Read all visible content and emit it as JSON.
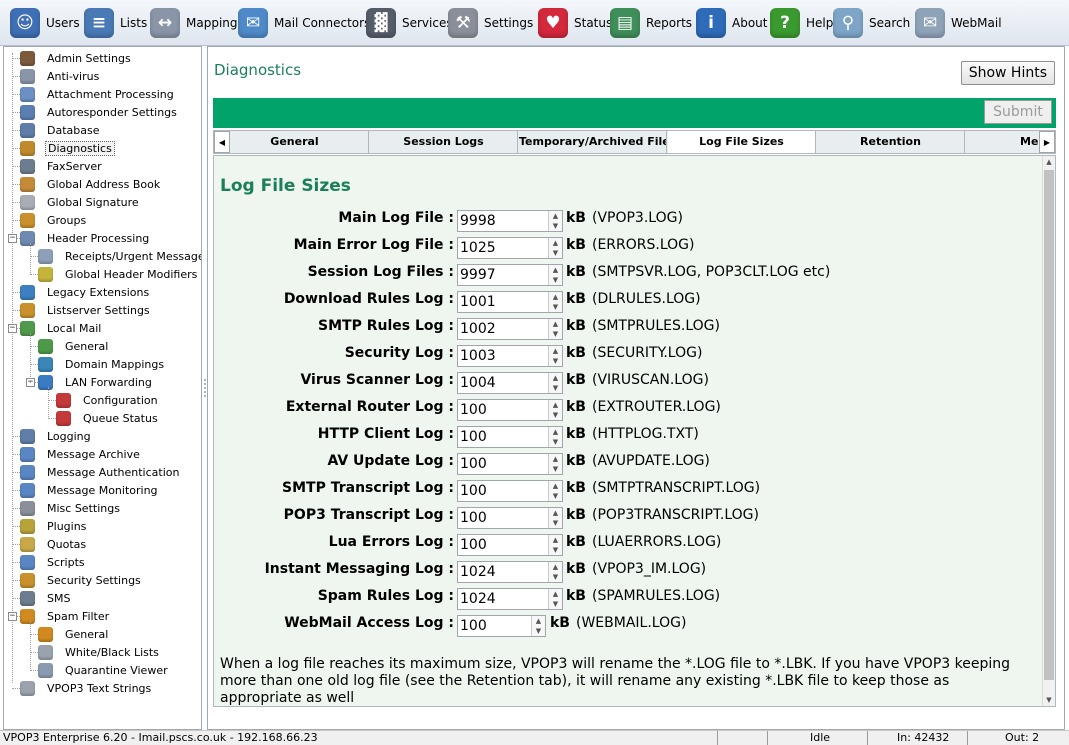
{
  "toolbar": {
    "items": [
      {
        "label": "Users",
        "icon": "users-icon",
        "color": "#3f6fb4",
        "glyph": "☺"
      },
      {
        "label": "Lists",
        "icon": "lists-icon",
        "color": "#4a7ab6",
        "glyph": "≡"
      },
      {
        "label": "Mappings",
        "icon": "mappings-icon",
        "color": "#8a96a8",
        "glyph": "↔"
      },
      {
        "label": "Mail Connectors",
        "icon": "mail-connectors-icon",
        "color": "#4e8ac9",
        "glyph": "✉"
      },
      {
        "label": "Services",
        "icon": "services-icon",
        "color": "#555d6b",
        "glyph": "▓"
      },
      {
        "label": "Settings",
        "icon": "settings-icon",
        "color": "#8a8f99",
        "glyph": "⚒"
      },
      {
        "label": "Status",
        "icon": "status-icon",
        "color": "#d4283c",
        "glyph": "♥"
      },
      {
        "label": "Reports",
        "icon": "reports-icon",
        "color": "#3f8f5a",
        "glyph": "▤"
      },
      {
        "label": "About",
        "icon": "about-icon",
        "color": "#2e6bb8",
        "glyph": "i"
      },
      {
        "label": "Help",
        "icon": "help-icon",
        "color": "#3b9a2f",
        "glyph": "?"
      },
      {
        "label": "Search",
        "icon": "search-icon",
        "color": "#7ea5c8",
        "glyph": "⚲"
      },
      {
        "label": "WebMail",
        "icon": "webmail-icon",
        "color": "#8fa3b8",
        "glyph": "✉"
      }
    ]
  },
  "tree": {
    "items": [
      {
        "label": "Admin Settings",
        "icon": "admin-settings-icon",
        "color": "#7c5a3c"
      },
      {
        "label": "Anti-virus",
        "icon": "anti-virus-icon",
        "color": "#8a95a8"
      },
      {
        "label": "Attachment Processing",
        "icon": "paperclip-icon",
        "color": "#6c8fc4"
      },
      {
        "label": "Autoresponder Settings",
        "icon": "autoresponder-icon",
        "color": "#5b7fb3"
      },
      {
        "label": "Database",
        "icon": "database-icon",
        "color": "#5f7ea8"
      },
      {
        "label": "Diagnostics",
        "icon": "diagnostics-icon",
        "color": "#c08a2a"
      },
      {
        "label": "FaxServer",
        "icon": "fax-icon",
        "color": "#6b7d8f"
      },
      {
        "label": "Global Address Book",
        "icon": "address-book-icon",
        "color": "#c48a3a"
      },
      {
        "label": "Global Signature",
        "icon": "signature-icon",
        "color": "#a8adb5"
      },
      {
        "label": "Groups",
        "icon": "groups-icon",
        "color": "#c9902d"
      },
      {
        "label": "Header Processing",
        "icon": "header-processing-icon",
        "color": "#6e8ab0"
      },
      {
        "label": "Receipts/Urgent Messages",
        "icon": "receipts-icon",
        "color": "#8ea0b8"
      },
      {
        "label": "Global Header Modifiers",
        "icon": "header-modifiers-icon",
        "color": "#c4b43a"
      },
      {
        "label": "Legacy Extensions",
        "icon": "legacy-extensions-icon",
        "color": "#3d7fc0"
      },
      {
        "label": "Listserver Settings",
        "icon": "listserver-icon",
        "color": "#c9902d"
      },
      {
        "label": "Local Mail",
        "icon": "local-mail-icon",
        "color": "#4f9a4a"
      },
      {
        "label": "General",
        "icon": "general-icon",
        "color": "#4f9a4a"
      },
      {
        "label": "Domain Mappings",
        "icon": "globe-icon",
        "color": "#3a86b8"
      },
      {
        "label": "LAN Forwarding",
        "icon": "lan-forwarding-icon",
        "color": "#3a7bc2"
      },
      {
        "label": "Configuration",
        "icon": "configuration-icon",
        "color": "#c43a3a"
      },
      {
        "label": "Queue Status",
        "icon": "queue-status-icon",
        "color": "#c43a3a"
      },
      {
        "label": "Logging",
        "icon": "logging-icon",
        "color": "#5f7ea8"
      },
      {
        "label": "Message Archive",
        "icon": "archive-icon",
        "color": "#5b86c4"
      },
      {
        "label": "Message Authentication",
        "icon": "authentication-icon",
        "color": "#5b86c4"
      },
      {
        "label": "Message Monitoring",
        "icon": "monitoring-icon",
        "color": "#5b86c4"
      },
      {
        "label": "Misc Settings",
        "icon": "misc-settings-icon",
        "color": "#8a8f99"
      },
      {
        "label": "Plugins",
        "icon": "plugins-icon",
        "color": "#b8a23a"
      },
      {
        "label": "Quotas",
        "icon": "quotas-icon",
        "color": "#c8a84a"
      },
      {
        "label": "Scripts",
        "icon": "scripts-icon",
        "color": "#5b86c4"
      },
      {
        "label": "Security Settings",
        "icon": "security-icon",
        "color": "#c9902d"
      },
      {
        "label": "SMS",
        "icon": "sms-icon",
        "color": "#6b7d8f"
      },
      {
        "label": "Spam Filter",
        "icon": "spam-filter-icon",
        "color": "#d08a1f"
      },
      {
        "label": "General",
        "icon": "spam-general-icon",
        "color": "#d08a1f"
      },
      {
        "label": "White/Black Lists",
        "icon": "white-black-lists-icon",
        "color": "#9aa3ad"
      },
      {
        "label": "Quarantine Viewer",
        "icon": "quarantine-icon",
        "color": "#8a9ab0"
      },
      {
        "label": "VPOP3 Text Strings",
        "icon": "text-strings-icon",
        "color": "#9aa3ad"
      }
    ]
  },
  "main": {
    "title": "Diagnostics",
    "show_hints_label": "Show Hints",
    "submit_label": "Submit",
    "tabs": [
      "General",
      "Session Logs",
      "Temporary/Archived Files",
      "Log File Sizes",
      "Retention",
      "Messa"
    ],
    "active_tab": "Log File Sizes",
    "section_title": "Log File Sizes",
    "unit": "kB",
    "rows": [
      {
        "label": "Main Log File :",
        "value": "9998",
        "file": "(VPOP3.LOG)"
      },
      {
        "label": "Main Error Log File :",
        "value": "1025",
        "file": "(ERRORS.LOG)"
      },
      {
        "label": "Session Log Files :",
        "value": "9997",
        "file": "(SMTPSVR.LOG, POP3CLT.LOG etc)"
      },
      {
        "label": "Download Rules Log :",
        "value": "1001",
        "file": "(DLRULES.LOG)"
      },
      {
        "label": "SMTP Rules Log :",
        "value": "1002",
        "file": "(SMTPRULES.LOG)"
      },
      {
        "label": "Security Log :",
        "value": "1003",
        "file": "(SECURITY.LOG)"
      },
      {
        "label": "Virus Scanner Log :",
        "value": "1004",
        "file": "(VIRUSCAN.LOG)"
      },
      {
        "label": "External Router Log :",
        "value": "100",
        "file": "(EXTROUTER.LOG)"
      },
      {
        "label": "HTTP Client Log :",
        "value": "100",
        "file": "(HTTPLOG.TXT)"
      },
      {
        "label": "AV Update Log :",
        "value": "100",
        "file": "(AVUPDATE.LOG)"
      },
      {
        "label": "SMTP Transcript Log :",
        "value": "100",
        "file": "(SMTPTRANSCRIPT.LOG)"
      },
      {
        "label": "POP3 Transcript Log :",
        "value": "100",
        "file": "(POP3TRANSCRIPT.LOG)"
      },
      {
        "label": "Lua Errors Log :",
        "value": "100",
        "file": "(LUAERRORS.LOG)"
      },
      {
        "label": "Instant Messaging Log :",
        "value": "1024",
        "file": "(VPOP3_IM.LOG)"
      },
      {
        "label": "Spam Rules Log :",
        "value": "1024",
        "file": "(SPAMRULES.LOG)"
      },
      {
        "label": "WebMail Access Log :",
        "value": "100",
        "file": "(WEBMAIL.LOG)"
      }
    ],
    "note": "When a log file reaches its maximum size, VPOP3 will rename the *.LOG file to *.LBK. If you have VPOP3 keeping more than one old log file (see the Retention tab), it will rename any existing *.LBK file to keep those as appropriate as well"
  },
  "status": {
    "info": "VPOP3 Enterprise 6.20 - Imail.pscs.co.uk - 192.168.66.23",
    "state": "Idle",
    "in": "In: 42432",
    "out": "Out: 2"
  },
  "colors": {
    "accent_green": "#00a36a",
    "title_green": "#1b7f5c",
    "content_bg": "#eef6ef"
  }
}
